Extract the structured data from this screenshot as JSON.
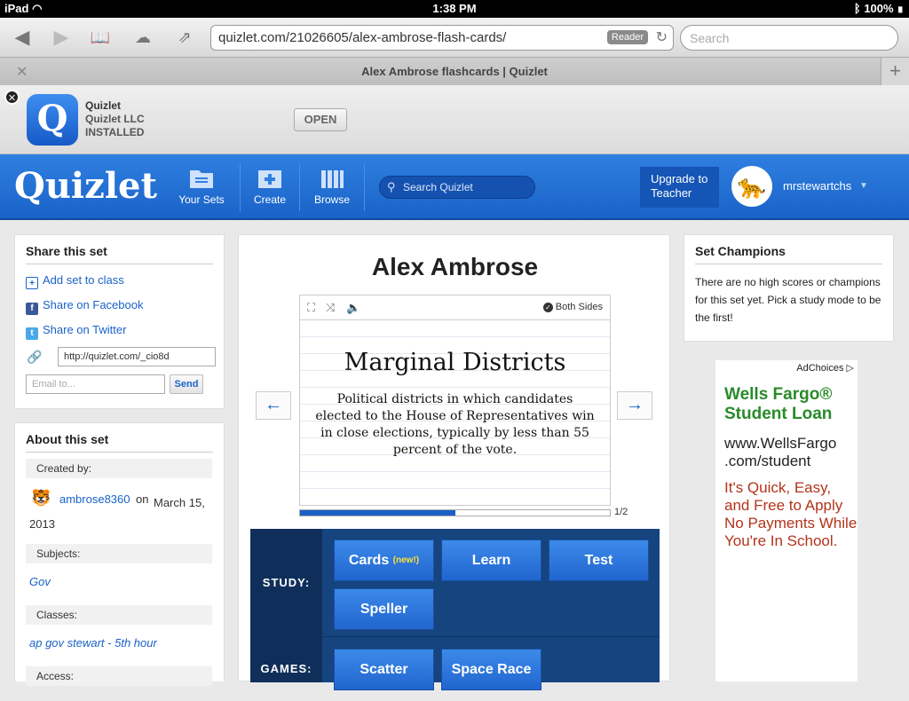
{
  "status": {
    "device": "iPad",
    "time": "1:38 PM",
    "battery": "100%"
  },
  "browser": {
    "url": "quizlet.com/21026605/alex-ambrose-flash-cards/",
    "reader": "Reader",
    "search_placeholder": "Search",
    "tab_title": "Alex Ambrose flashcards | Quizlet"
  },
  "banner": {
    "app_name": "Quizlet",
    "developer": "Quizlet LLC",
    "state": "INSTALLED",
    "open_label": "OPEN",
    "icon_letter": "Q"
  },
  "header": {
    "logo": "Quizlet",
    "nav": [
      {
        "label": "Your Sets"
      },
      {
        "label": "Create"
      },
      {
        "label": "Browse"
      }
    ],
    "search_placeholder": "Search Quizlet",
    "upgrade": "Upgrade to Teacher",
    "username": "mrstewartchs"
  },
  "share": {
    "title": "Share this set",
    "add_class": "Add set to class",
    "facebook": "Share on Facebook",
    "twitter": "Share on Twitter",
    "short_url": "http://quizlet.com/_cio8d",
    "email_placeholder": "Email to...",
    "send": "Send"
  },
  "about": {
    "title": "About this set",
    "created_label": "Created by:",
    "author": "ambrose8360",
    "date_prefix": "on",
    "date": "March 15, 2013",
    "subjects_label": "Subjects:",
    "subject": "Gov",
    "classes_label": "Classes:",
    "class": "ap gov stewart - 5th hour",
    "access_label": "Access:"
  },
  "set": {
    "title": "Alex Ambrose",
    "both_sides": "Both Sides",
    "term": "Marginal Districts",
    "definition": "Political districts in which candidates elected to the House of Representatives win in close elections, typically by less than 55 percent of the vote.",
    "prev": "←",
    "next": "→",
    "progress": 0.5,
    "count": "1/2"
  },
  "modes": {
    "study_label": "STUDY:",
    "games_label": "GAMES:",
    "cards": "Cards",
    "cards_badge": "(new!)",
    "learn": "Learn",
    "test": "Test",
    "speller": "Speller",
    "scatter": "Scatter",
    "space_race": "Space Race"
  },
  "champions": {
    "title": "Set Champions",
    "text": "There are no high scores or champions for this set yet. Pick a study mode to be the first!"
  },
  "ad": {
    "choices": "AdChoices",
    "headline": "Wells Fargo® Student Loan",
    "url": "www.WellsFargo .com/student",
    "body": "It's Quick, Easy, and Free to Apply No Payments While You're In School."
  }
}
